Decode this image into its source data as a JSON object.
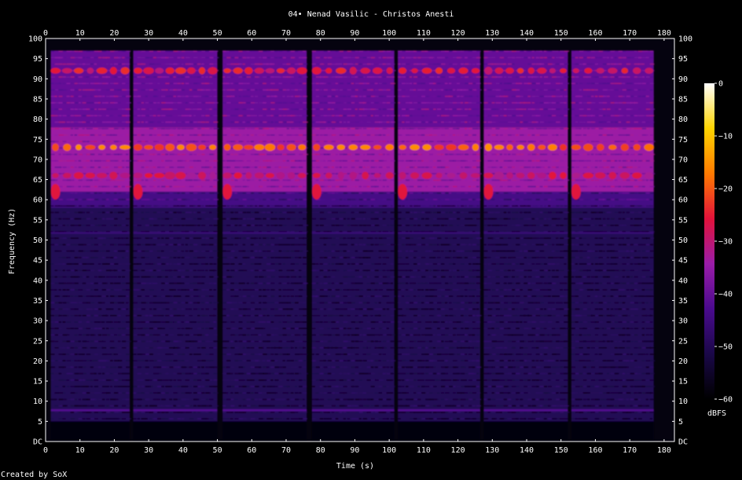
{
  "chart_data": {
    "type": "heatmap",
    "title": "04• Nenad Vasilic - Christos Anesti",
    "xlabel": "Time (s)",
    "ylabel": "Frequency (Hz)",
    "x_ticks": [
      "0",
      "10",
      "20",
      "30",
      "40",
      "50",
      "60",
      "70",
      "80",
      "90",
      "100",
      "110",
      "120",
      "130",
      "140",
      "150",
      "160",
      "170",
      "180"
    ],
    "y_ticks": [
      "DC",
      "5",
      "10",
      "15",
      "20",
      "25",
      "30",
      "35",
      "40",
      "45",
      "50",
      "55",
      "60",
      "65",
      "70",
      "75",
      "80",
      "85",
      "90",
      "95",
      "100"
    ],
    "xlim": [
      0,
      183
    ],
    "ylim": [
      0,
      100
    ],
    "signal_end_s": 177,
    "colorbar": {
      "label": "dBFS",
      "ticks": [
        "0",
        "−10",
        "−20",
        "−30",
        "−40",
        "−50",
        "−60"
      ],
      "range": [
        -60,
        0
      ],
      "stops": [
        "#000000",
        "#1a0848",
        "#4a0a8e",
        "#9a1ca8",
        "#e2123a",
        "#ff7a00",
        "#ffd400",
        "#ffffff"
      ]
    },
    "segments": [
      {
        "start": 1.5,
        "end": 24.5
      },
      {
        "start": 25.5,
        "end": 50.0
      },
      {
        "start": 51.5,
        "end": 76.0
      },
      {
        "start": 77.5,
        "end": 101.5
      },
      {
        "start": 102.5,
        "end": 126.5
      },
      {
        "start": 127.5,
        "end": 152.0
      },
      {
        "start": 153.0,
        "end": 177.0
      }
    ],
    "bands_dbfs": [
      {
        "low_hz": 0,
        "high_hz": 5,
        "dbfs": -58
      },
      {
        "low_hz": 5,
        "high_hz": 58,
        "dbfs": -50
      },
      {
        "low_hz": 58,
        "high_hz": 62,
        "dbfs": -44
      },
      {
        "low_hz": 62,
        "high_hz": 78,
        "dbfs": -34
      },
      {
        "low_hz": 78,
        "high_hz": 97,
        "dbfs": -40
      }
    ],
    "hot_bands_hz": [
      {
        "center": 73,
        "dbfs": -20
      },
      {
        "center": 92,
        "dbfs": -28
      },
      {
        "center": 66,
        "dbfs": -30
      }
    ],
    "line_bands_hz": [
      {
        "center": 7.5,
        "dbfs": -42
      },
      {
        "center": 51.5,
        "dbfs": -46
      }
    ]
  },
  "footer": {
    "credit": "Created by SoX"
  }
}
